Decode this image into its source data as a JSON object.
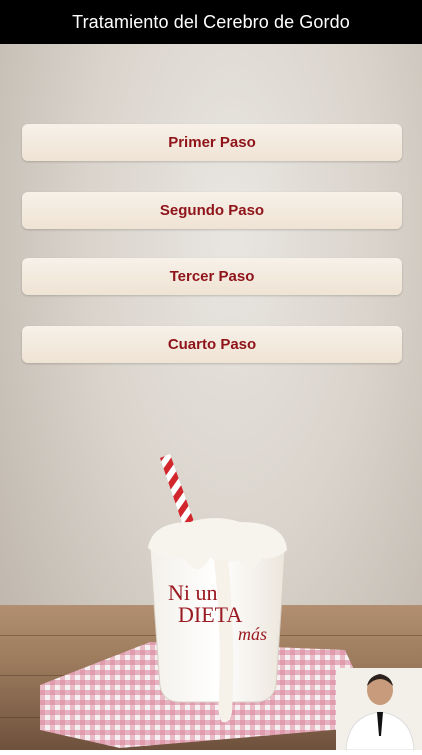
{
  "header": {
    "title": "Tratamiento del Cerebro de Gordo"
  },
  "menu": {
    "items": [
      {
        "label": "Primer Paso"
      },
      {
        "label": "Segundo Paso"
      },
      {
        "label": "Tercer Paso"
      },
      {
        "label": "Cuarto Paso"
      }
    ]
  },
  "decor": {
    "logo_text": [
      "Ni un",
      "DIETA",
      "más"
    ]
  },
  "colors": {
    "accent": "#8f141a",
    "button_bg": "#f3ebe0",
    "header_bg": "#000000"
  }
}
